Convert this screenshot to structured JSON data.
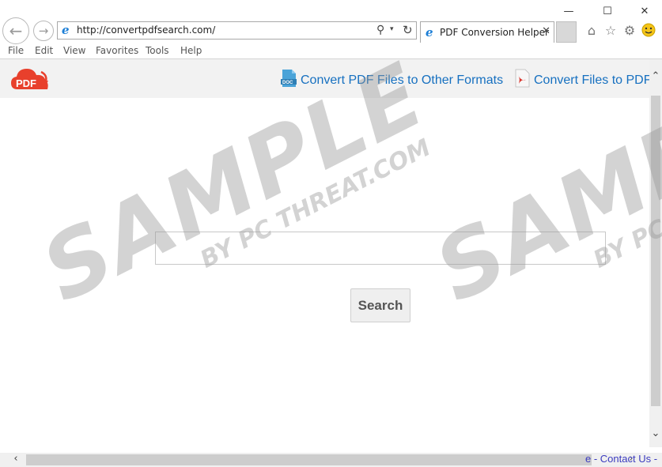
{
  "browser": {
    "url": "http://convertpdfsearch.com/",
    "tab_title": "PDF Conversion Helper",
    "tab_close": "✕",
    "menu": [
      "File",
      "Edit",
      "View",
      "Favorites",
      "Tools",
      "Help"
    ]
  },
  "header": {
    "logo_text": "PDF",
    "links": [
      "Convert PDF Files to Other Formats",
      "Convert Files to PDF"
    ],
    "doc_badge": "DOC"
  },
  "search": {
    "placeholder": "",
    "button_label": "Search"
  },
  "footer": {
    "partial_text": "e - Contact Us -"
  },
  "watermark": {
    "main": "SAMPLE",
    "sub": "BY PC THREAT.COM"
  },
  "colors": {
    "link": "#1670c0",
    "logo_red": "#e8402c",
    "doc_blue": "#4aa3d8"
  }
}
